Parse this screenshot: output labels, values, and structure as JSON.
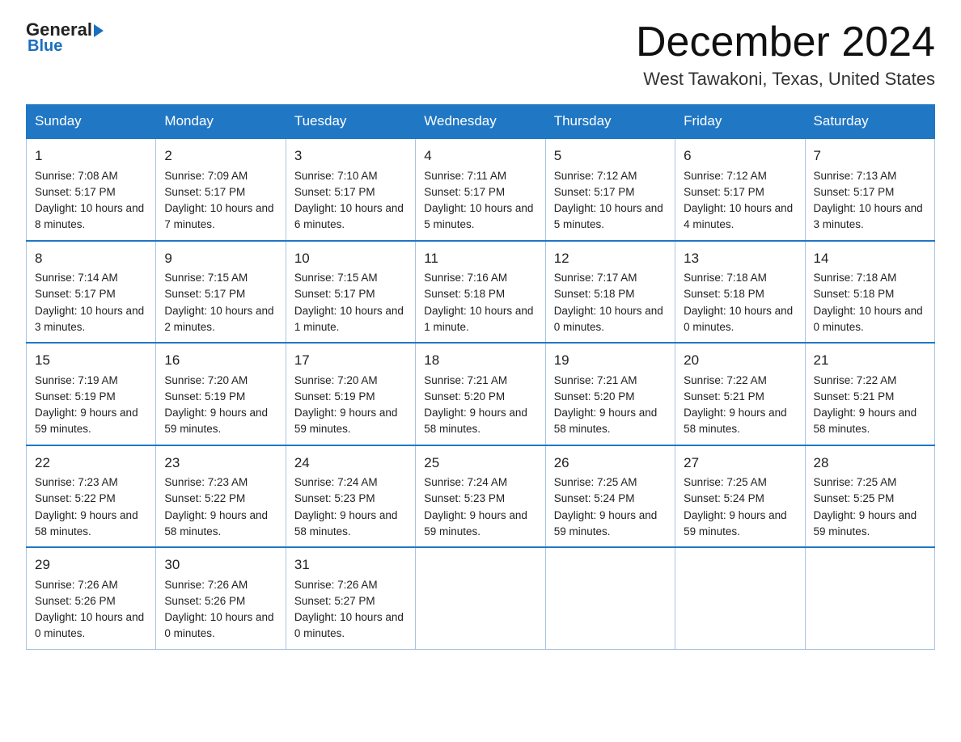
{
  "logo": {
    "name_part1": "General",
    "name_part2": "Blue"
  },
  "title": "December 2024",
  "location": "West Tawakoni, Texas, United States",
  "days_of_week": [
    "Sunday",
    "Monday",
    "Tuesday",
    "Wednesday",
    "Thursday",
    "Friday",
    "Saturday"
  ],
  "weeks": [
    [
      {
        "day": "1",
        "sunrise": "7:08 AM",
        "sunset": "5:17 PM",
        "daylight": "10 hours and 8 minutes."
      },
      {
        "day": "2",
        "sunrise": "7:09 AM",
        "sunset": "5:17 PM",
        "daylight": "10 hours and 7 minutes."
      },
      {
        "day": "3",
        "sunrise": "7:10 AM",
        "sunset": "5:17 PM",
        "daylight": "10 hours and 6 minutes."
      },
      {
        "day": "4",
        "sunrise": "7:11 AM",
        "sunset": "5:17 PM",
        "daylight": "10 hours and 5 minutes."
      },
      {
        "day": "5",
        "sunrise": "7:12 AM",
        "sunset": "5:17 PM",
        "daylight": "10 hours and 5 minutes."
      },
      {
        "day": "6",
        "sunrise": "7:12 AM",
        "sunset": "5:17 PM",
        "daylight": "10 hours and 4 minutes."
      },
      {
        "day": "7",
        "sunrise": "7:13 AM",
        "sunset": "5:17 PM",
        "daylight": "10 hours and 3 minutes."
      }
    ],
    [
      {
        "day": "8",
        "sunrise": "7:14 AM",
        "sunset": "5:17 PM",
        "daylight": "10 hours and 3 minutes."
      },
      {
        "day": "9",
        "sunrise": "7:15 AM",
        "sunset": "5:17 PM",
        "daylight": "10 hours and 2 minutes."
      },
      {
        "day": "10",
        "sunrise": "7:15 AM",
        "sunset": "5:17 PM",
        "daylight": "10 hours and 1 minute."
      },
      {
        "day": "11",
        "sunrise": "7:16 AM",
        "sunset": "5:18 PM",
        "daylight": "10 hours and 1 minute."
      },
      {
        "day": "12",
        "sunrise": "7:17 AM",
        "sunset": "5:18 PM",
        "daylight": "10 hours and 0 minutes."
      },
      {
        "day": "13",
        "sunrise": "7:18 AM",
        "sunset": "5:18 PM",
        "daylight": "10 hours and 0 minutes."
      },
      {
        "day": "14",
        "sunrise": "7:18 AM",
        "sunset": "5:18 PM",
        "daylight": "10 hours and 0 minutes."
      }
    ],
    [
      {
        "day": "15",
        "sunrise": "7:19 AM",
        "sunset": "5:19 PM",
        "daylight": "9 hours and 59 minutes."
      },
      {
        "day": "16",
        "sunrise": "7:20 AM",
        "sunset": "5:19 PM",
        "daylight": "9 hours and 59 minutes."
      },
      {
        "day": "17",
        "sunrise": "7:20 AM",
        "sunset": "5:19 PM",
        "daylight": "9 hours and 59 minutes."
      },
      {
        "day": "18",
        "sunrise": "7:21 AM",
        "sunset": "5:20 PM",
        "daylight": "9 hours and 58 minutes."
      },
      {
        "day": "19",
        "sunrise": "7:21 AM",
        "sunset": "5:20 PM",
        "daylight": "9 hours and 58 minutes."
      },
      {
        "day": "20",
        "sunrise": "7:22 AM",
        "sunset": "5:21 PM",
        "daylight": "9 hours and 58 minutes."
      },
      {
        "day": "21",
        "sunrise": "7:22 AM",
        "sunset": "5:21 PM",
        "daylight": "9 hours and 58 minutes."
      }
    ],
    [
      {
        "day": "22",
        "sunrise": "7:23 AM",
        "sunset": "5:22 PM",
        "daylight": "9 hours and 58 minutes."
      },
      {
        "day": "23",
        "sunrise": "7:23 AM",
        "sunset": "5:22 PM",
        "daylight": "9 hours and 58 minutes."
      },
      {
        "day": "24",
        "sunrise": "7:24 AM",
        "sunset": "5:23 PM",
        "daylight": "9 hours and 58 minutes."
      },
      {
        "day": "25",
        "sunrise": "7:24 AM",
        "sunset": "5:23 PM",
        "daylight": "9 hours and 59 minutes."
      },
      {
        "day": "26",
        "sunrise": "7:25 AM",
        "sunset": "5:24 PM",
        "daylight": "9 hours and 59 minutes."
      },
      {
        "day": "27",
        "sunrise": "7:25 AM",
        "sunset": "5:24 PM",
        "daylight": "9 hours and 59 minutes."
      },
      {
        "day": "28",
        "sunrise": "7:25 AM",
        "sunset": "5:25 PM",
        "daylight": "9 hours and 59 minutes."
      }
    ],
    [
      {
        "day": "29",
        "sunrise": "7:26 AM",
        "sunset": "5:26 PM",
        "daylight": "10 hours and 0 minutes."
      },
      {
        "day": "30",
        "sunrise": "7:26 AM",
        "sunset": "5:26 PM",
        "daylight": "10 hours and 0 minutes."
      },
      {
        "day": "31",
        "sunrise": "7:26 AM",
        "sunset": "5:27 PM",
        "daylight": "10 hours and 0 minutes."
      },
      null,
      null,
      null,
      null
    ]
  ]
}
